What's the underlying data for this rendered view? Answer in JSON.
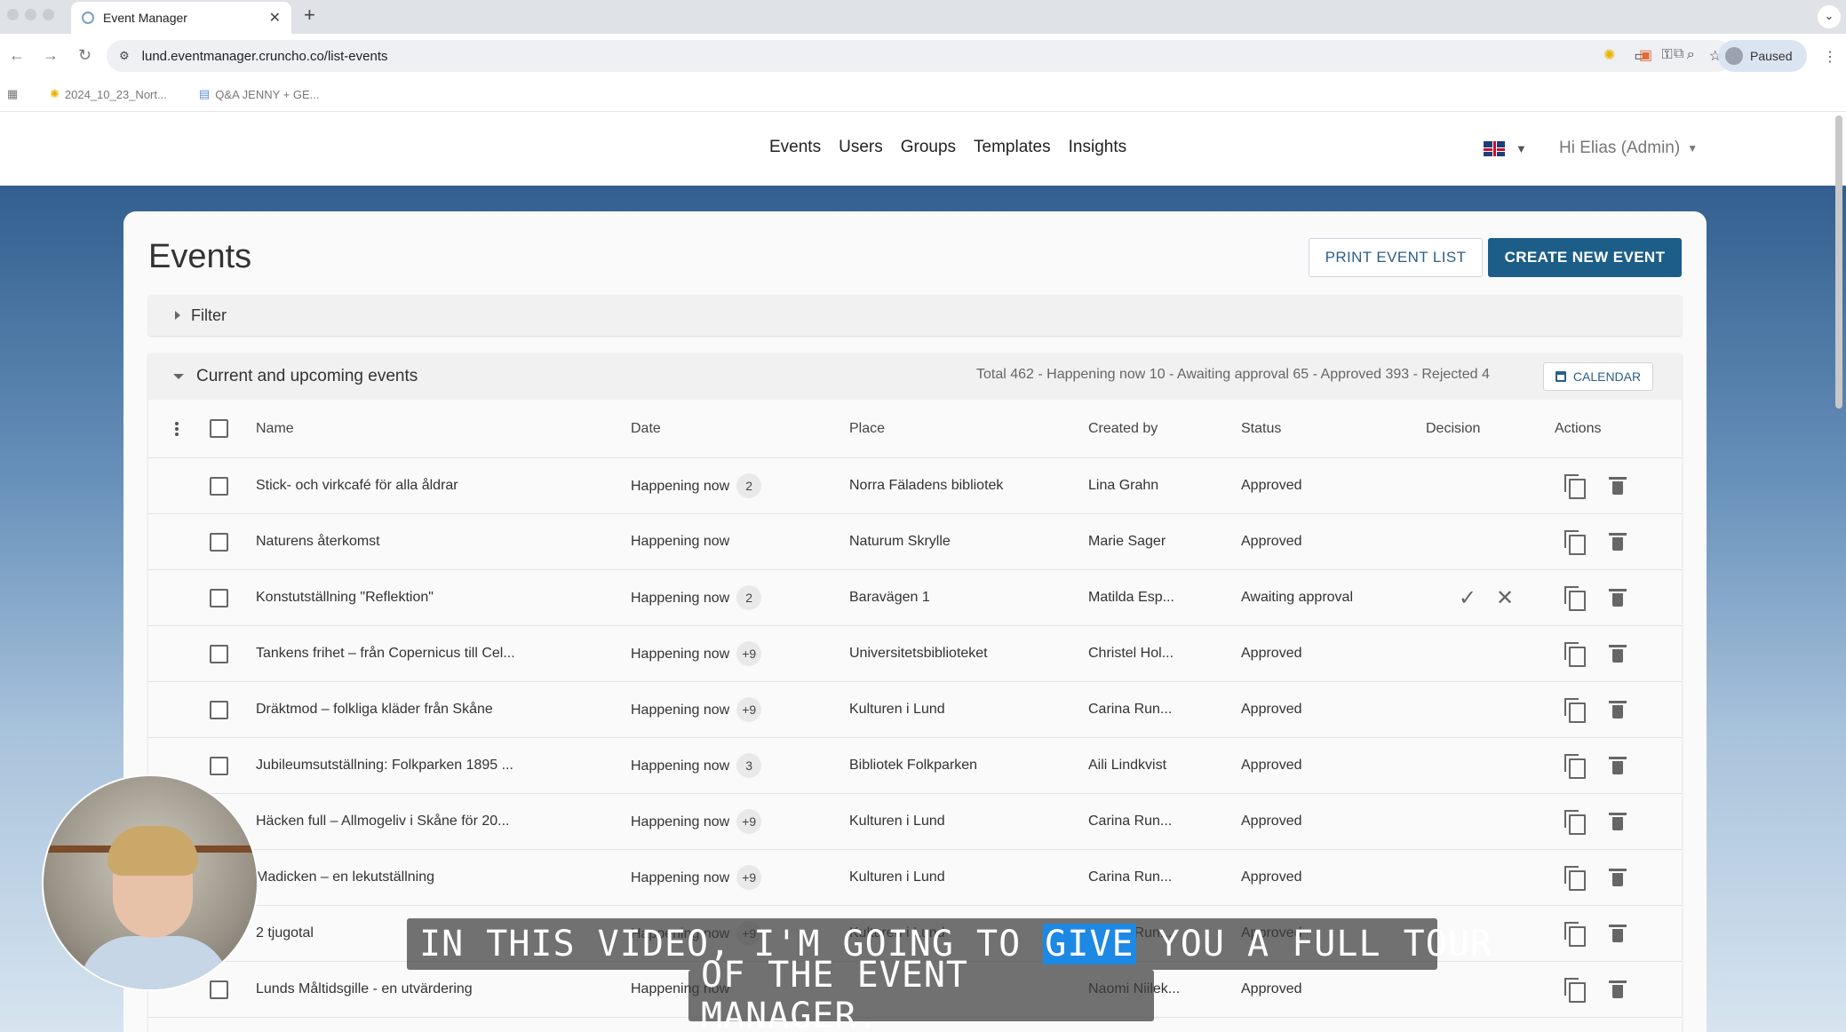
{
  "browser": {
    "tab_title": "Event Manager",
    "url": "lund.eventmanager.cruncho.co/list-events",
    "profile_status": "Paused",
    "bookmarks": [
      "2024_10_23_Nort...",
      "Q&A JENNY + GE..."
    ]
  },
  "nav": {
    "items": [
      "Events",
      "Users",
      "Groups",
      "Templates",
      "Insights"
    ],
    "user_greeting": "Hi Elias (Admin)"
  },
  "page": {
    "title": "Events",
    "print_button": "PRINT EVENT LIST",
    "create_button": "CREATE NEW EVENT",
    "filter_label": "Filter"
  },
  "section": {
    "title": "Current and upcoming events",
    "summary": "Total 462 - Happening now 10 - Awaiting approval 65 - Approved 393 - Rejected 4",
    "calendar_button": "CALENDAR"
  },
  "table": {
    "headers": {
      "name": "Name",
      "date": "Date",
      "place": "Place",
      "created_by": "Created by",
      "status": "Status",
      "decision": "Decision",
      "actions": "Actions"
    },
    "rows": [
      {
        "name": "Stick- och virkcafé för alla åldrar",
        "date": "Happening now",
        "badge": "2",
        "place": "Norra Fäladens bibliotek",
        "created_by": "Lina Grahn",
        "status": "Approved"
      },
      {
        "name": "Naturens återkomst",
        "date": "Happening now",
        "badge": "",
        "place": "Naturum Skrylle",
        "created_by": "Marie Sager",
        "status": "Approved"
      },
      {
        "name": "Konstutställning \"Reflektion\"",
        "date": "Happening now",
        "badge": "2",
        "place": "Baravägen 1",
        "created_by": "Matilda Esp...",
        "status": "Awaiting approval",
        "decision": true
      },
      {
        "name": "Tankens frihet – från Copernicus till Cel...",
        "date": "Happening now",
        "badge": "+9",
        "place": "Universitetsbiblioteket",
        "created_by": "Christel Hol...",
        "status": "Approved"
      },
      {
        "name": "Dräktmod – folkliga kläder från Skåne",
        "date": "Happening now",
        "badge": "+9",
        "place": "Kulturen i Lund",
        "created_by": "Carina Run...",
        "status": "Approved"
      },
      {
        "name": "Jubileumsutställning: Folkparken 1895 ...",
        "date": "Happening now",
        "badge": "3",
        "place": "Bibliotek Folkparken",
        "created_by": "Aili Lindkvist",
        "status": "Approved"
      },
      {
        "name": "Häcken full – Allmogeliv i Skåne för 20...",
        "date": "Happening now",
        "badge": "+9",
        "place": "Kulturen i Lund",
        "created_by": "Carina Run...",
        "status": "Approved"
      },
      {
        "name": "Madicken – en lekutställning",
        "date": "Happening now",
        "badge": "+9",
        "place": "Kulturen i Lund",
        "created_by": "Carina Run...",
        "status": "Approved"
      },
      {
        "name": "2 tjugotal",
        "date": "Happening now",
        "badge": "+9",
        "place": "Kulturen i Lund",
        "created_by": "Carina Run...",
        "status": "Approved"
      },
      {
        "name": "Lunds Måltidsgille - en utvärdering",
        "date": "Happening now",
        "badge": "",
        "place": "",
        "created_by": "Naomi Niilek...",
        "status": "Approved"
      }
    ]
  },
  "captions": {
    "line1_before": "IN THIS VIDEO, I'M GOING TO ",
    "line1_highlight": "GIVE",
    "line1_after": " YOU A FULL TOUR",
    "line2": "OF THE EVENT MANAGER."
  },
  "colors": {
    "primary": "#1d5e89",
    "link": "#2b5f87",
    "caption_highlight": "#1e88e5"
  }
}
